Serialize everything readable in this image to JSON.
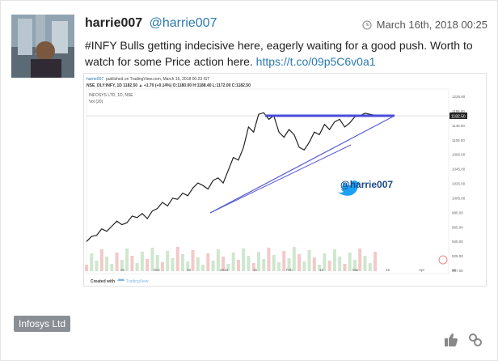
{
  "post": {
    "author_name": "harrie007",
    "author_handle": "@harrie007",
    "timestamp": "March 16th, 2018 00:25",
    "text": "#INFY Bulls getting indecisive here, eagerly waiting for a good push. Worth to watch for some Price action here. ",
    "link": "https://t.co/09p5C6v0a1",
    "tag": "Infosys Ltd"
  },
  "chart_image": {
    "publisher": "harrie007",
    "published_text": "published on TradingView.com, March 16, 2018 00:23 IST",
    "ohlc_line": "NSE_DLY:INFY, 1D  1182.50  ▲ +1.70 (+0.14%)  O:1180.00  H:1188.40  L:1172.00  C:1182.50",
    "legend_title": "INFOSYS LTD, 1D, NSE",
    "legend_vol": "Vol (20)",
    "watermark": "@harrie007",
    "footer_created": "Created with",
    "footer_brand": "TradingView",
    "price_label": "1182.50",
    "y_ticks": [
      "1225.00",
      "1185.00",
      "1145.00",
      "1105.00",
      "1065.00",
      "1045.00",
      "1025.00",
      "1005.00",
      "985.00",
      "965.00",
      "945.00",
      "925.00",
      "907.00"
    ],
    "x_ticks": [
      "20",
      "Dec",
      "18",
      "2018",
      "15",
      "Feb",
      "15",
      "Mar",
      "15",
      "Apr",
      "16"
    ]
  },
  "chart_data": {
    "type": "line",
    "title": "INFOSYS LTD, 1D, NSE",
    "ylim": [
      907,
      1225
    ],
    "series": [
      {
        "name": "INFOSYS LTD",
        "values": [
          935,
          945,
          947,
          960,
          955,
          965,
          975,
          968,
          972,
          985,
          982,
          990,
          980,
          995,
          1000,
          1012,
          1005,
          1020,
          1018,
          1030,
          1025,
          1040,
          1050,
          1045,
          1038,
          1055,
          1060,
          1050,
          1075,
          1100,
          1095,
          1120,
          1160,
          1150,
          1185,
          1188,
          1175,
          1182,
          1150,
          1140,
          1155,
          1145,
          1120,
          1115,
          1130,
          1150,
          1145,
          1165,
          1155,
          1170,
          1175,
          1160,
          1168,
          1180,
          1182,
          1187,
          1185,
          1183
        ]
      }
    ]
  }
}
